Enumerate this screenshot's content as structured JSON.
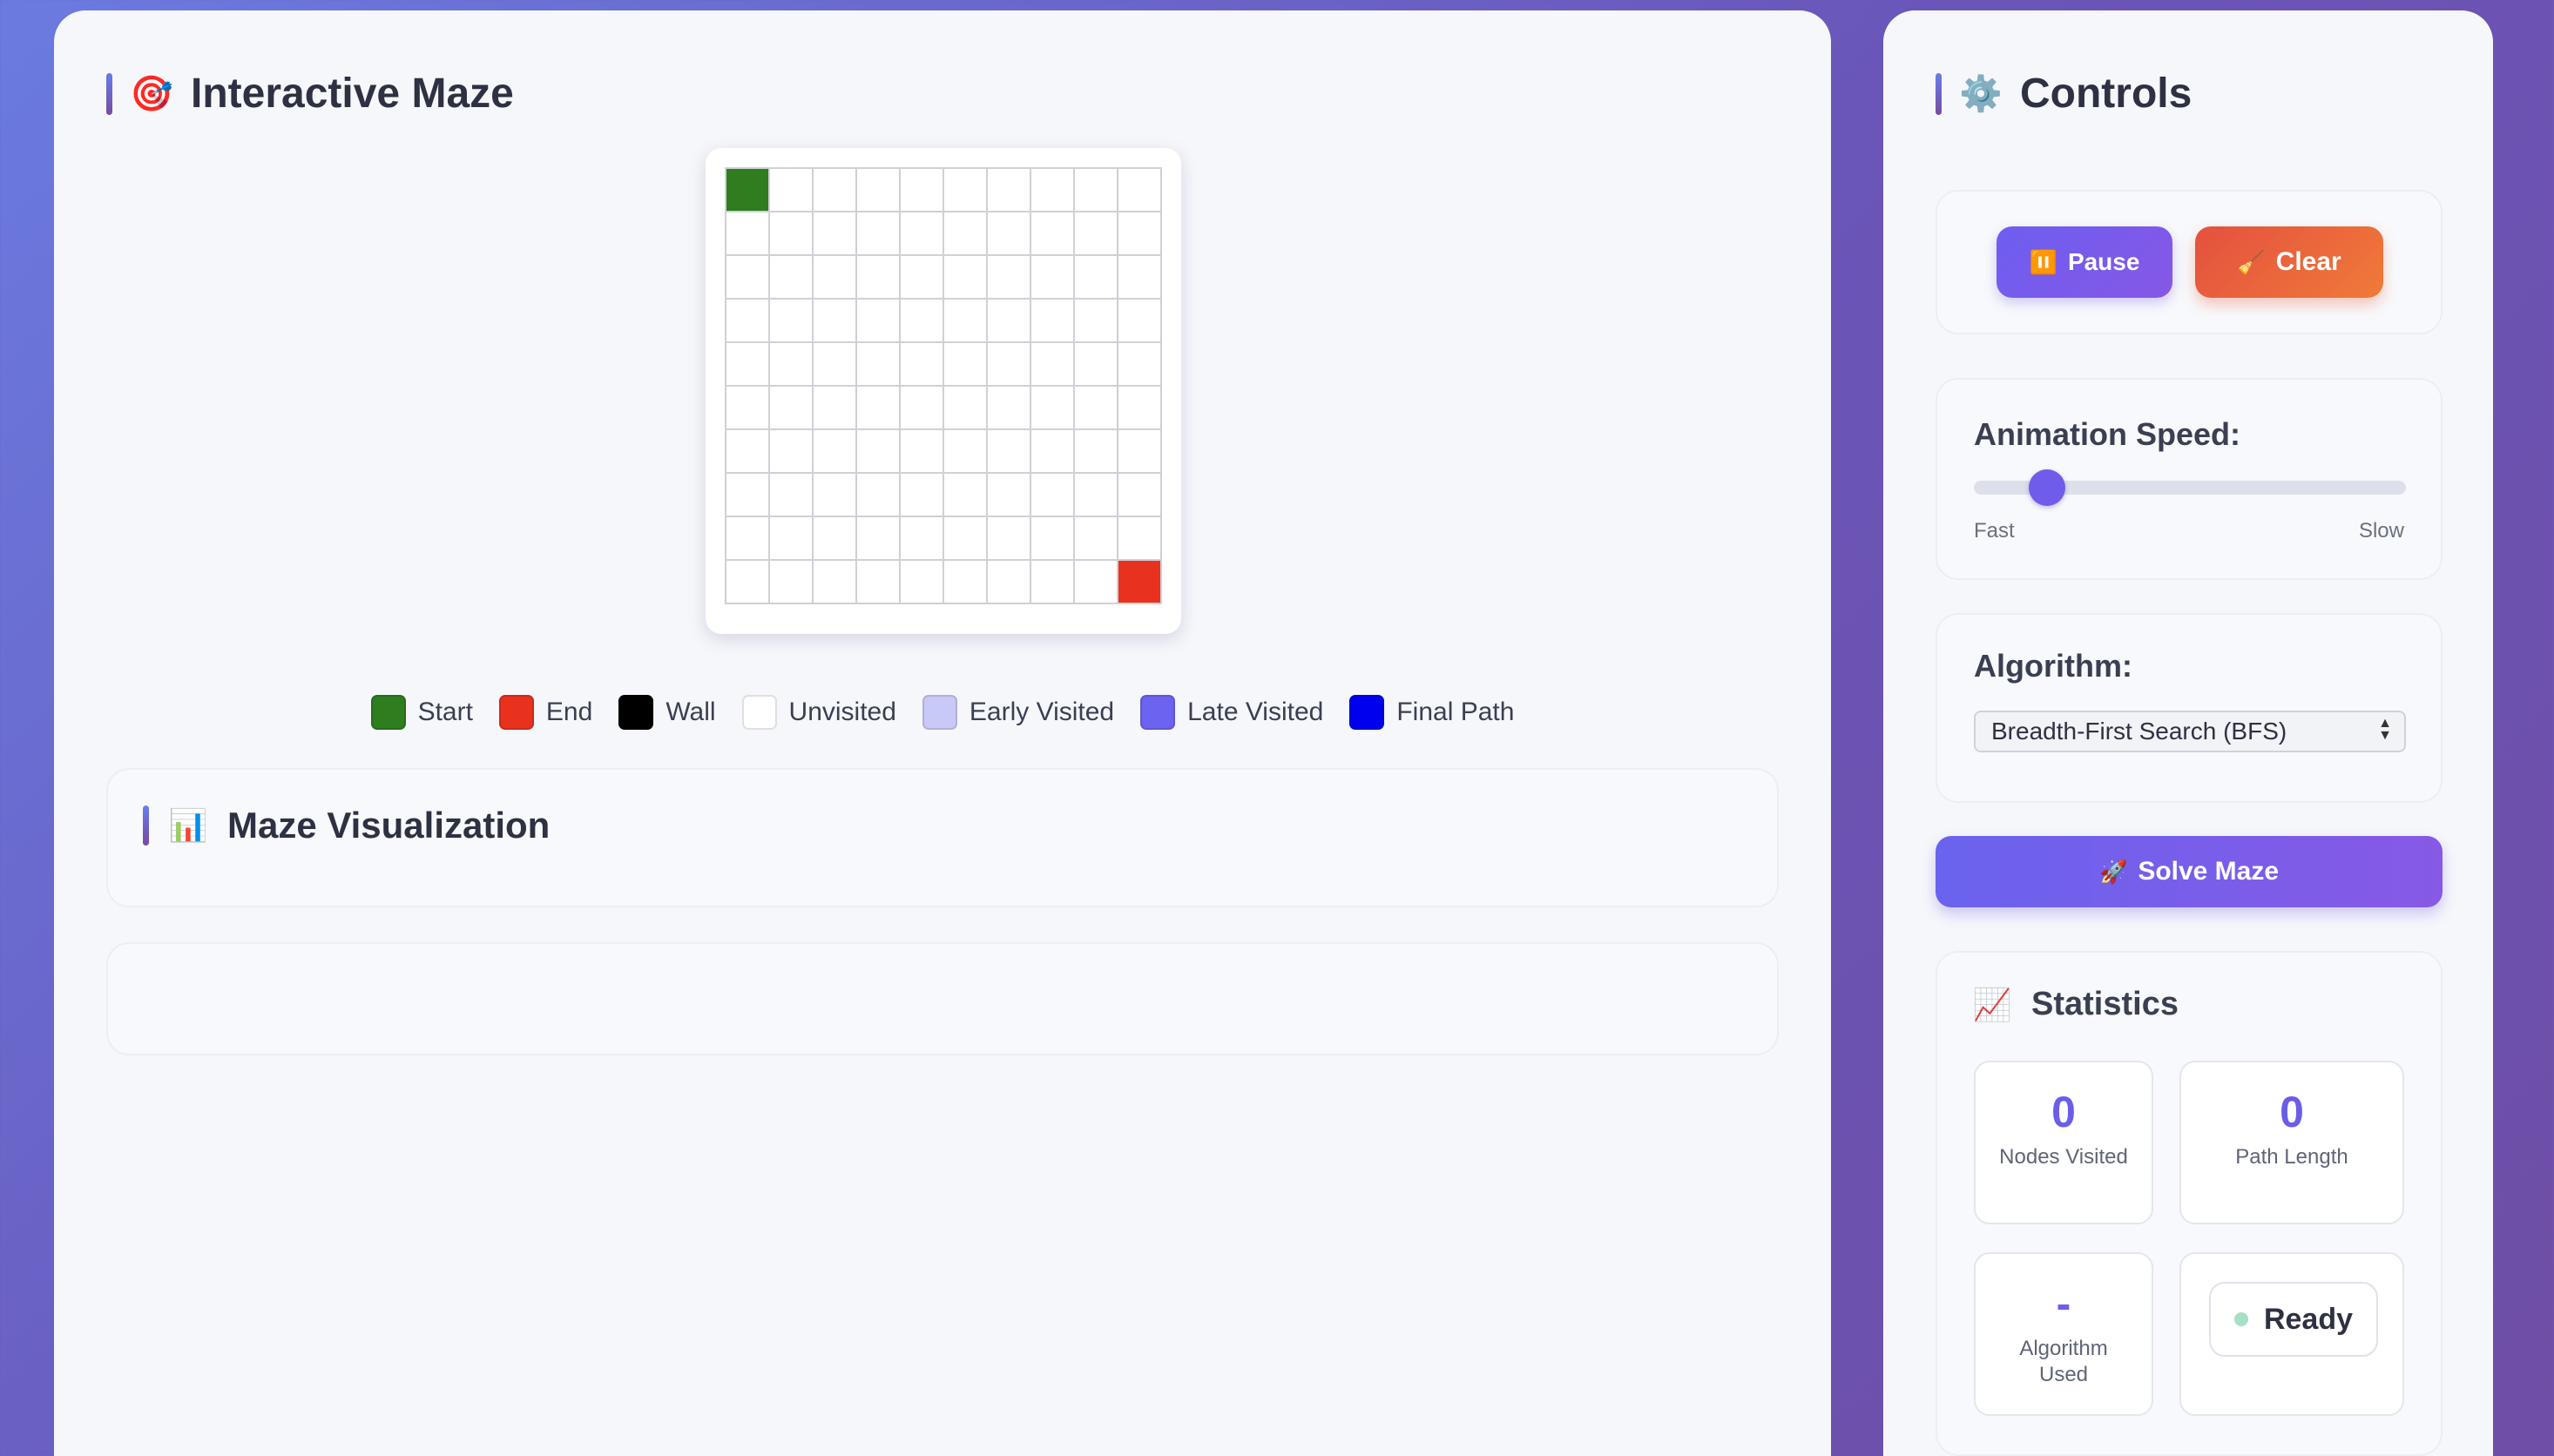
{
  "maze_panel": {
    "title": "Interactive Maze",
    "title_icon": "target-icon",
    "grid": {
      "rows": 10,
      "cols": 10,
      "start": [
        0,
        0
      ],
      "end": [
        9,
        9
      ]
    },
    "legend": [
      {
        "label": "Start",
        "color": "#2e7d1f"
      },
      {
        "label": "End",
        "color": "#e8321e"
      },
      {
        "label": "Wall",
        "color": "#000000"
      },
      {
        "label": "Unvisited",
        "color": "#ffffff"
      },
      {
        "label": "Early Visited",
        "color": "#c9c9f7"
      },
      {
        "label": "Late Visited",
        "color": "#6c63f0"
      },
      {
        "label": "Final Path",
        "color": "#0000ee"
      }
    ],
    "visualization": {
      "title": "Maze Visualization",
      "icon": "bar-chart-icon"
    }
  },
  "controls": {
    "title": "Controls",
    "title_icon": "gear-icon",
    "pause_label": "Pause",
    "pause_icon": "pause-icon",
    "clear_label": "Clear",
    "clear_icon": "broom-icon",
    "speed": {
      "label": "Animation Speed:",
      "min_label": "Fast",
      "max_label": "Slow",
      "value_fraction": 0.17
    },
    "algorithm": {
      "label": "Algorithm:",
      "selected": "Breadth-First Search (BFS)"
    },
    "solve_label": "Solve Maze",
    "solve_icon": "rocket-icon",
    "statistics": {
      "title": "Statistics",
      "icon": "chart-increasing-icon",
      "nodes_visited": {
        "value": "0",
        "label": "Nodes Visited"
      },
      "path_length": {
        "value": "0",
        "label": "Path Length"
      },
      "algorithm_used": {
        "value": "-",
        "label": "Algorithm Used"
      },
      "status": "Ready"
    }
  }
}
